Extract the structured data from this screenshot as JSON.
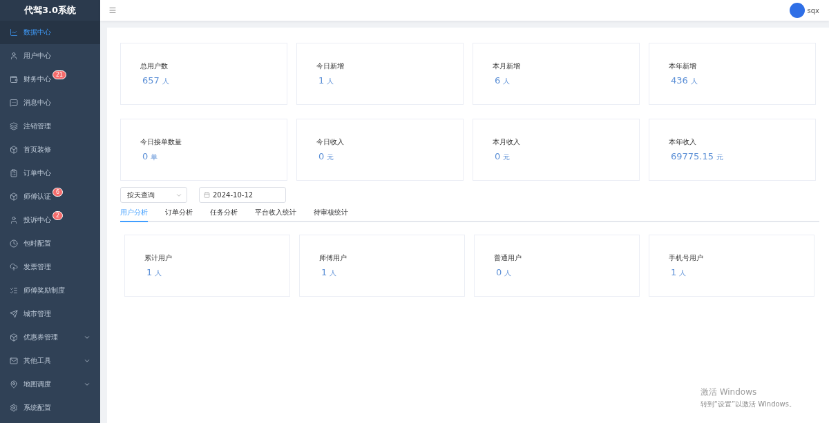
{
  "sidebar": {
    "title": "代驾3.0系统",
    "items": [
      {
        "label": "数据中心",
        "selected": true,
        "kind": "link"
      },
      {
        "label": "用户中心",
        "selected": false,
        "kind": "link"
      },
      {
        "label": "财务中心",
        "selected": false,
        "kind": "link",
        "badge": "21"
      },
      {
        "label": "消息中心",
        "selected": false,
        "kind": "link"
      },
      {
        "label": "注销管理",
        "selected": false,
        "kind": "link"
      },
      {
        "label": "首页装修",
        "selected": false,
        "kind": "link"
      },
      {
        "label": "订单中心",
        "selected": false,
        "kind": "link"
      },
      {
        "label": "师傅认证",
        "selected": false,
        "kind": "link",
        "badge": "6"
      },
      {
        "label": "投诉中心",
        "selected": false,
        "kind": "link",
        "badge": "2"
      },
      {
        "label": "包时配置",
        "selected": false,
        "kind": "link"
      },
      {
        "label": "发票管理",
        "selected": false,
        "kind": "link"
      },
      {
        "label": "师傅奖励制度",
        "selected": false,
        "kind": "link"
      },
      {
        "label": "城市管理",
        "selected": false,
        "kind": "link"
      },
      {
        "label": "优惠券管理",
        "selected": false,
        "kind": "group"
      },
      {
        "label": "其他工具",
        "selected": false,
        "kind": "group"
      },
      {
        "label": "地图调度",
        "selected": false,
        "kind": "group"
      },
      {
        "label": "系统配置",
        "selected": false,
        "kind": "link"
      }
    ]
  },
  "header": {
    "user": "sqx"
  },
  "summary_cards": [
    {
      "label": "总用户数",
      "value": "657",
      "unit": "人"
    },
    {
      "label": "今日新增",
      "value": "1",
      "unit": "人"
    },
    {
      "label": "本月新增",
      "value": "6",
      "unit": "人"
    },
    {
      "label": "本年新增",
      "value": "436",
      "unit": "人"
    },
    {
      "label": "今日接单数量",
      "value": "0",
      "unit": "单"
    },
    {
      "label": "今日收入",
      "value": "0",
      "unit": "元"
    },
    {
      "label": "本月收入",
      "value": "0",
      "unit": "元"
    },
    {
      "label": "本年收入",
      "value": "69775.15",
      "unit": "元"
    }
  ],
  "filters": {
    "mode": "按天查询",
    "date": "2024-10-12"
  },
  "tabs": [
    {
      "label": "用户分析",
      "selected": true
    },
    {
      "label": "订单分析",
      "selected": false
    },
    {
      "label": "任务分析",
      "selected": false
    },
    {
      "label": "平台收入统计",
      "selected": false
    },
    {
      "label": "待审核统计",
      "selected": false
    }
  ],
  "user_cards": [
    {
      "label": "累计用户",
      "value": "1",
      "unit": "人"
    },
    {
      "label": "师傅用户",
      "value": "1",
      "unit": "人"
    },
    {
      "label": "普通用户",
      "value": "0",
      "unit": "人"
    },
    {
      "label": "手机号用户",
      "value": "1",
      "unit": "人"
    }
  ],
  "os_notice": {
    "title": "激活 Windows",
    "text": "转到“设置”以激活 Windows。"
  }
}
